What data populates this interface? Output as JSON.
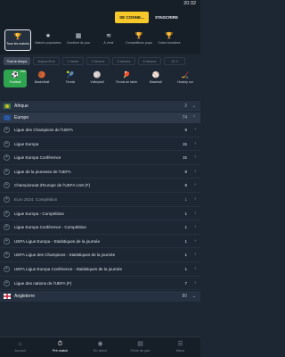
{
  "status": {
    "time": "20:32"
  },
  "auth": {
    "login": "SE CONNE...",
    "register": "S'INSCRIRE"
  },
  "quick_filters": [
    {
      "icon": "trophy-icon",
      "glyph": "🏆",
      "label": "Tous les matchs"
    },
    {
      "icon": "star-icon",
      "glyph": "★",
      "label": "Matchs populaires"
    },
    {
      "icon": "calendar-icon",
      "glyph": "▦",
      "label": "Combiné du jour"
    },
    {
      "icon": "wifi-icon",
      "glyph": "≋",
      "label": "À venir"
    },
    {
      "icon": "trophy-icon",
      "glyph": "🏆",
      "label": "Compétitions populaires"
    },
    {
      "icon": "trophy-icon",
      "glyph": "🏆",
      "label": "Cotes boostées"
    }
  ],
  "time_filters": [
    "Tout le temps",
    "Aujourd'hui",
    "1 heure",
    "2 heures",
    "3 heures",
    "6 heures",
    "12 h"
  ],
  "sports": [
    {
      "icon": "football-icon",
      "glyph": "⚽",
      "label": "Football",
      "badge": "4399"
    },
    {
      "icon": "basketball-icon",
      "glyph": "🏀",
      "label": "Basketball",
      "badge": ""
    },
    {
      "icon": "tennis-icon",
      "glyph": "🎾",
      "label": "Tennis",
      "badge": ""
    },
    {
      "icon": "volleyball-icon",
      "glyph": "🏐",
      "label": "Volleyball",
      "badge": ""
    },
    {
      "icon": "table-tennis-icon",
      "glyph": "🏓",
      "label": "Tennis de table",
      "badge": ""
    },
    {
      "icon": "baseball-icon",
      "glyph": "⚾",
      "label": "Baseball",
      "badge": ""
    },
    {
      "icon": "hockey-icon",
      "glyph": "🏒",
      "label": "Hockey sur",
      "badge": ""
    }
  ],
  "list": {
    "africa": {
      "name": "Afrique",
      "count": "2"
    },
    "europe": {
      "name": "Europe",
      "count": "74"
    },
    "leagues": [
      {
        "name": "Ligue des Champions de l'UEFA",
        "count": "8"
      },
      {
        "name": "Ligue Europa",
        "count": "15"
      },
      {
        "name": "Ligue Europa Conférence",
        "count": "15"
      },
      {
        "name": "Ligue de la jeunesse de l'UEFA",
        "count": "8"
      },
      {
        "name": "Championnat d'Europe de l'UEFA U19 (F)",
        "count": "8"
      },
      {
        "name": "Euro 2024. Compétition",
        "count": "1"
      },
      {
        "name": "Ligue Europa - Compétition",
        "count": "1"
      },
      {
        "name": "Ligue Europa Conférence - Compétition",
        "count": "1"
      },
      {
        "name": "UEFA Ligue Europa - Statistiques de la journée",
        "count": "1"
      },
      {
        "name": "UEFA Ligue des Champions - Statistiques de la journée",
        "count": "1"
      },
      {
        "name": "UEFA Ligue Europa Conférence - Statistiques de la journée",
        "count": "1"
      },
      {
        "name": "Ligue des nations de l'UEFA (F)",
        "count": "7"
      }
    ],
    "england": {
      "name": "Angleterre",
      "count": "80"
    }
  },
  "bottom_nav": [
    {
      "icon": "home-icon",
      "glyph": "⌂",
      "label": "Accueil"
    },
    {
      "icon": "prematch-icon",
      "glyph": "⏱",
      "label": "Pré-match"
    },
    {
      "icon": "live-icon",
      "glyph": "◉",
      "label": "En direct"
    },
    {
      "icon": "betslip-icon",
      "glyph": "▤",
      "label": "Fiche de pari"
    },
    {
      "icon": "menu-icon",
      "glyph": "☰",
      "label": "Menu"
    }
  ]
}
